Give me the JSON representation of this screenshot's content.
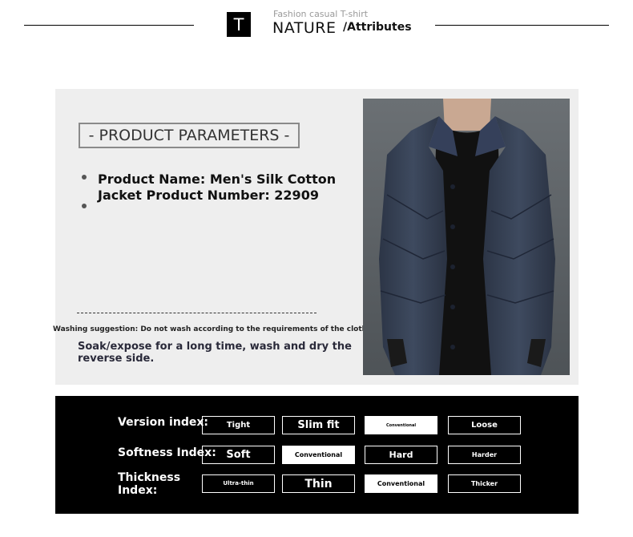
{
  "header": {
    "badge_letter": "T",
    "small_text": "Fashion casual T-shirt",
    "nature": "NATURE",
    "attributes": "/Attributes"
  },
  "parameters": {
    "title": "- PRODUCT PARAMETERS -",
    "product_line": "Product Name: Men's Silk Cotton Jacket Product Number: 22909",
    "washing_suggestion": "Washing suggestion: Do not wash according to the requirements of the clothing tag",
    "soak_note": "Soak/expose for a long time, wash and dry the reverse side."
  },
  "indices": [
    {
      "label": "Version index:",
      "options": [
        "Tight",
        "Slim fit",
        "Conventional",
        "Loose"
      ],
      "selected": 2
    },
    {
      "label": "Softness Index:",
      "options": [
        "Soft",
        "Conventional",
        "Hard",
        "Harder"
      ],
      "selected": 1
    },
    {
      "label": "Thickness Index:",
      "options": [
        "Ultra-thin",
        "Thin",
        "Conventional",
        "Thicker"
      ],
      "selected": 2
    }
  ],
  "colors": {
    "panel_bg": "#eeeeee",
    "band_bg": "#000000",
    "jacket": "#3a4558"
  }
}
